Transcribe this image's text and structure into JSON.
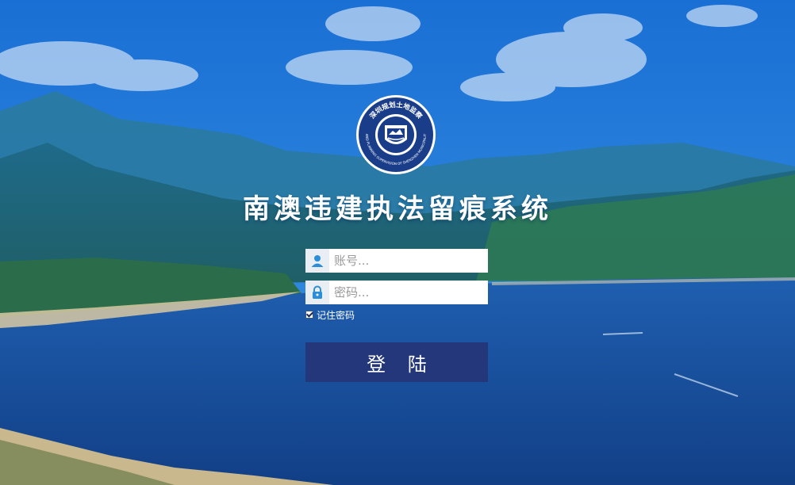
{
  "page": {
    "title": "南澳违建执法留痕系统"
  },
  "logo": {
    "top_text": "深圳规划土地监察",
    "bottom_text": "LAND PLANNING SUPERVISION OF SHENZHEN MUNICIPALITY"
  },
  "login": {
    "username_placeholder": "账号...",
    "password_placeholder": "密码...",
    "remember_label": "记住密码",
    "remember_checked": true,
    "submit_label": "登 陆"
  },
  "colors": {
    "button_bg": "#23377a",
    "sky": "#1f78d6",
    "sea": "#1a5aa3"
  }
}
